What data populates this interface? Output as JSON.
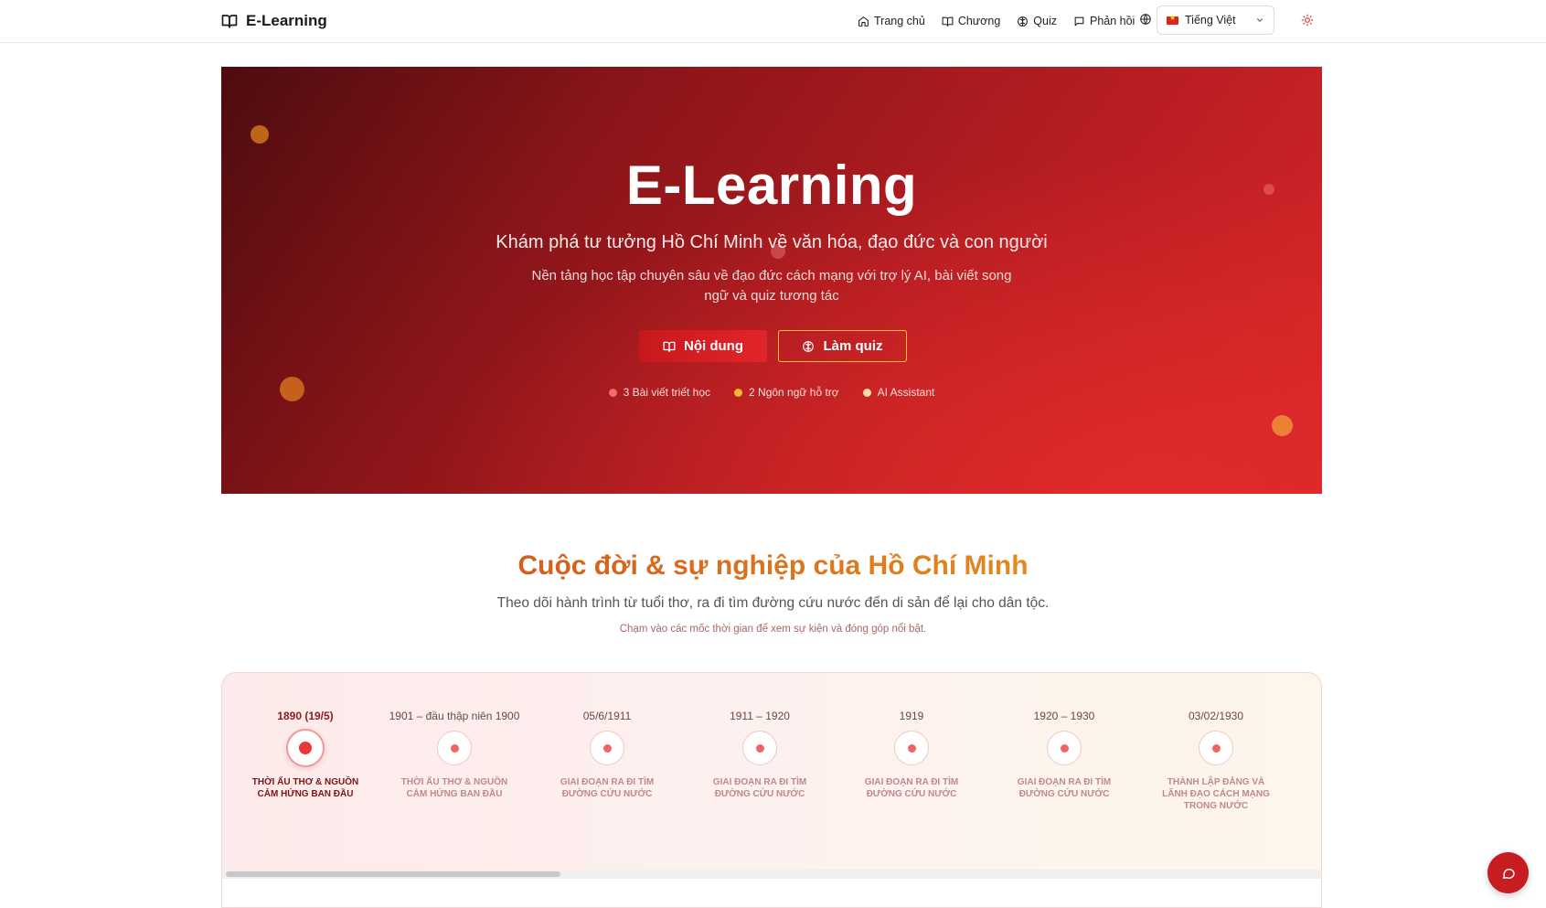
{
  "header": {
    "logo_text": "E-Learning",
    "nav": [
      {
        "label": "Trang chủ",
        "icon": "home-icon"
      },
      {
        "label": "Chương",
        "icon": "book-icon"
      },
      {
        "label": "Quiz",
        "icon": "brain-icon"
      },
      {
        "label": "Phản hồi",
        "icon": "message-icon"
      }
    ],
    "language": {
      "selected": "Tiếng Việt",
      "flag": "vn-flag-icon"
    },
    "theme_toggle_icon": "sun-icon"
  },
  "hero": {
    "title": "E-Learning",
    "subtitle": "Khám phá tư tưởng Hồ Chí Minh về văn hóa, đạo đức và con người",
    "description": "Nền tảng học tập chuyên sâu về đạo đức cách mạng với trợ lý AI, bài viết song ngữ và quiz tương tác",
    "primary_button": "Nội dung",
    "secondary_button": "Làm quiz",
    "stats": [
      {
        "label": "3 Bài viết triết học",
        "color": "#f26d6d"
      },
      {
        "label": "2 Ngôn ngữ hỗ trợ",
        "color": "#f5b82e"
      },
      {
        "label": "AI Assistant",
        "color": "#f7d9b0"
      }
    ]
  },
  "section": {
    "title": "Cuộc đời & sự nghiệp của Hồ Chí Minh",
    "subtitle": "Theo dõi hành trình từ tuổi thơ, ra đi tìm đường cứu nước đến di sản để lại cho dân tộc.",
    "hint": "Chạm vào các mốc thời gian để xem sự kiện và đóng góp nổi bật."
  },
  "timeline": [
    {
      "date": "1890 (19/5)",
      "label": "Thời ấu thơ & nguồn cảm hứng ban đầu",
      "active": true
    },
    {
      "date": "1901 – đầu thập niên 1900",
      "label": "Thời ấu thơ & nguồn cảm hứng ban đầu",
      "active": false
    },
    {
      "date": "05/6/1911",
      "label": "Giai đoạn ra đi tìm đường cứu nước",
      "active": false
    },
    {
      "date": "1911 – 1920",
      "label": "Giai đoạn ra đi tìm đường cứu nước",
      "active": false
    },
    {
      "date": "1919",
      "label": "Giai đoạn ra đi tìm đường cứu nước",
      "active": false
    },
    {
      "date": "1920 – 1930",
      "label": "Giai đoạn ra đi tìm đường cứu nước",
      "active": false
    },
    {
      "date": "03/02/1930",
      "label": "Thành lập Đảng và lãnh đạo cách mạng trong nước",
      "active": false
    }
  ],
  "chat_fab_icon": "chat-icon"
}
